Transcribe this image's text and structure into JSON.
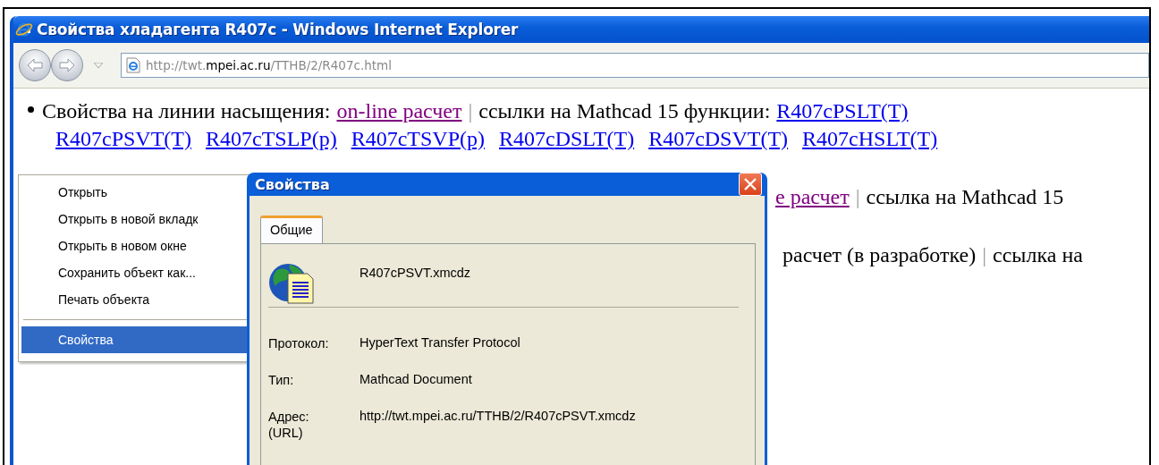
{
  "window": {
    "title": "Свойства хладагента R407c - Windows Internet Explorer"
  },
  "address_bar": {
    "url_parts": [
      {
        "text": "http://twt.",
        "kind": "dim"
      },
      {
        "text": "mpei.ac.ru",
        "kind": "domain"
      },
      {
        "text": "/TTHB/2/R407c.html",
        "kind": "dim"
      }
    ]
  },
  "content": {
    "lines": [
      {
        "kind": "bullet",
        "segments": [
          {
            "kind": "text",
            "text": "Свойства на линии насыщения:"
          },
          {
            "kind": "visited",
            "text": "on-line расчет"
          },
          {
            "kind": "separator",
            "text": "|"
          },
          {
            "kind": "text",
            "text": "ссылки на Mathcad 15 функции:"
          },
          {
            "kind": "link",
            "text": "R407cPSLT(T)"
          }
        ]
      },
      {
        "kind": "links",
        "segments": [
          {
            "kind": "link",
            "text": "R407cPSVT(T)"
          },
          {
            "kind": "link",
            "text": "R407cTSLP(p)"
          },
          {
            "kind": "link",
            "text": "R407cTSVP(p)"
          },
          {
            "kind": "link",
            "text": "R407cDSLT(T)"
          },
          {
            "kind": "link",
            "text": "R407cDSVT(T)"
          },
          {
            "kind": "link",
            "text": "R407cHSLT(T)"
          }
        ]
      },
      {
        "kind": "partial",
        "segments": [
          {
            "kind": "visited",
            "text": "е расчет"
          },
          {
            "kind": "separator",
            "text": "|"
          },
          {
            "kind": "text",
            "text": "ссылка на Mathcad 15"
          }
        ]
      },
      {
        "kind": "partial",
        "segments": [
          {
            "kind": "text",
            "text": "расчет (в разработке)"
          },
          {
            "kind": "separator",
            "text": "|"
          },
          {
            "kind": "text",
            "text": "ссылка на"
          }
        ]
      }
    ]
  },
  "context_menu": {
    "items": [
      {
        "kind": "item",
        "label": "Открыть",
        "selected": false
      },
      {
        "kind": "item",
        "label": "Открыть в новой вкладк",
        "selected": false
      },
      {
        "kind": "item",
        "label": "Открыть в новом окне",
        "selected": false
      },
      {
        "kind": "item",
        "label": "Сохранить объект как...",
        "selected": false
      },
      {
        "kind": "item",
        "label": "Печать объекта",
        "selected": false
      },
      {
        "kind": "separator"
      },
      {
        "kind": "item",
        "label": "Свойства",
        "selected": true
      }
    ]
  },
  "dialog": {
    "title": "Свойства",
    "tabs": [
      {
        "label": "Общие",
        "selected": true
      }
    ],
    "file_name": "R407cPSVT.xmcdz",
    "properties": [
      {
        "label": "Протокол:",
        "value": "HyperText Transfer Protocol"
      },
      {
        "label": "Тип:",
        "value": "Mathcad Document"
      },
      {
        "label": "Адрес: (URL)",
        "value": "http://twt.mpei.ac.ru/TTHB/2/R407cPSVT.xmcdz"
      }
    ]
  }
}
